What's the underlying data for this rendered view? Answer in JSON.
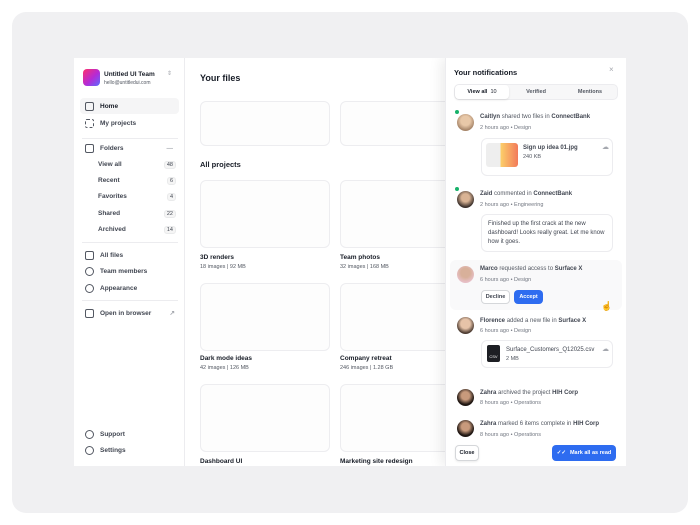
{
  "team": {
    "name": "Untitled UI Team",
    "email": "hello@untitledui.com"
  },
  "nav": {
    "home": "Home",
    "projects": "My projects",
    "folders": "Folders",
    "all_files": "All files",
    "team_members": "Team members",
    "appearance": "Appearance",
    "open_browser": "Open in browser",
    "support": "Support",
    "settings": "Settings"
  },
  "folders": [
    {
      "label": "View all",
      "count": "48"
    },
    {
      "label": "Recent",
      "count": "6"
    },
    {
      "label": "Favorites",
      "count": "4"
    },
    {
      "label": "Shared",
      "count": "22"
    },
    {
      "label": "Archived",
      "count": "14"
    }
  ],
  "main": {
    "your_files": "Your files",
    "all_projects": "All projects"
  },
  "projects": [
    {
      "name": "3D renders",
      "images": "18 images",
      "size": "92 MB"
    },
    {
      "name": "Team photos",
      "images": "32 images",
      "size": "168 MB"
    },
    {
      "name": "Dark mode ideas",
      "images": "42 images",
      "size": "126 MB"
    },
    {
      "name": "Company retreat",
      "images": "246 images",
      "size": "1.28 GB"
    },
    {
      "name": "Dashboard UI"
    },
    {
      "name": "Marketing site redesign"
    }
  ],
  "notifications": {
    "title": "Your notifications",
    "tabs": [
      {
        "label": "View all",
        "count": "10"
      },
      {
        "label": "Verified"
      },
      {
        "label": "Mentions"
      }
    ],
    "items": [
      {
        "name": "Caitlyn",
        "action": "shared two files in",
        "target": "ConnectBank",
        "time": "2 hours ago",
        "tag": "Design",
        "file": "Sign up idea 01.jpg",
        "file_size": "240 KB"
      },
      {
        "name": "Zaid",
        "action": "commented in",
        "target": "ConnectBank",
        "time": "2 hours ago",
        "tag": "Engineering",
        "comment": "Finished up the first crack at the new dashboard! Looks really great. Let me know how it goes."
      },
      {
        "name": "Marco",
        "action": "requested access to",
        "target": "Surface X",
        "time": "6 hours ago",
        "tag": "Design",
        "decline": "Decline",
        "accept": "Accept"
      },
      {
        "name": "Florence",
        "action": "added a new file in",
        "target": "Surface X",
        "time": "6 hours ago",
        "tag": "Design",
        "file": "Surface_Customers_Q12025.csv",
        "file_size": "2 MB",
        "file_type": "CSV"
      },
      {
        "name": "Zahra",
        "action": "archived the project",
        "target": "HIH Corp",
        "time": "8 hours ago",
        "tag": "Operations"
      },
      {
        "name": "Zahra",
        "action": "marked 6 items complete in",
        "target": "HIH Corp",
        "time": "8 hours ago",
        "tag": "Operations"
      }
    ],
    "close": "Close",
    "mark_all": "Mark all as read"
  },
  "colors": {
    "accent": "#2e6cf0",
    "online": "#17b26a"
  }
}
